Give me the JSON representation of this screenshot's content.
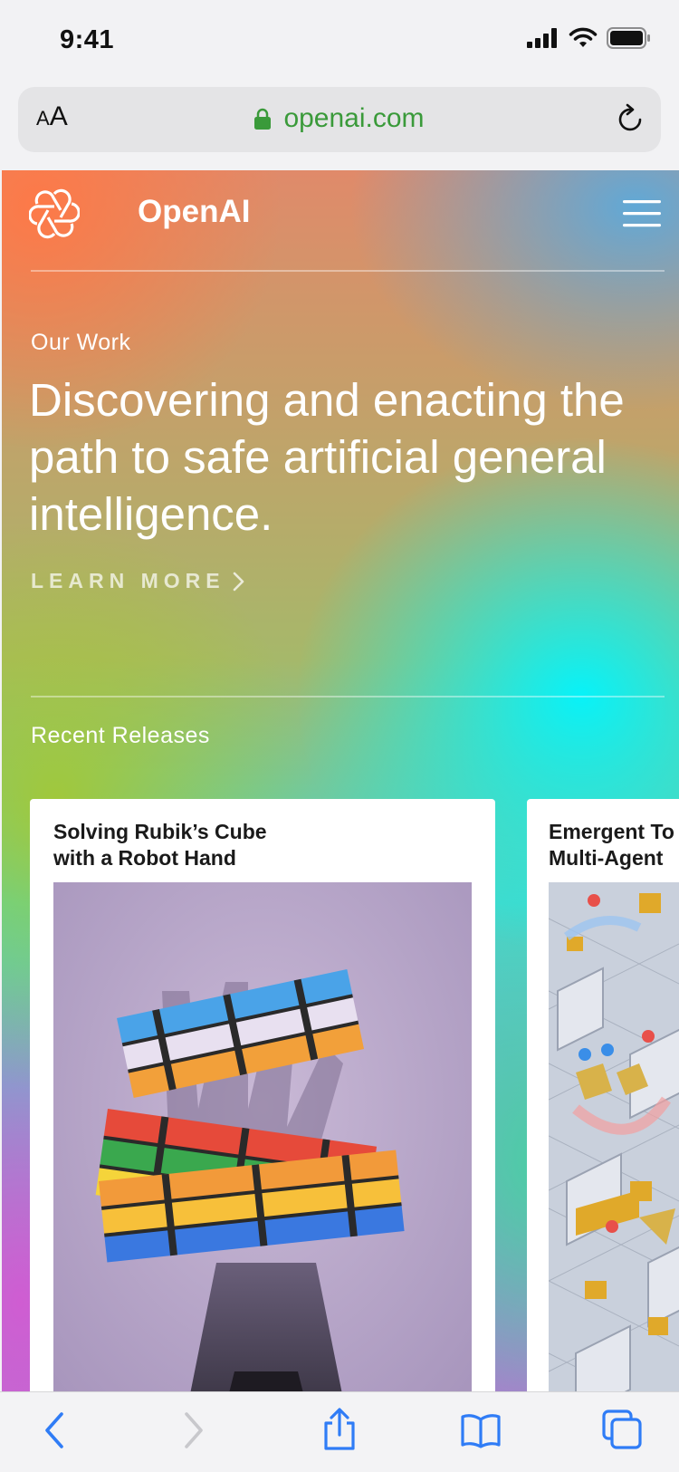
{
  "status_bar": {
    "time": "9:41"
  },
  "url_bar": {
    "text_size_small": "A",
    "text_size_large": "A",
    "url": "openai.com"
  },
  "site": {
    "brand": "OpenAI",
    "section_label": "Our Work",
    "headline": "Discovering and enacting the path to safe artificial general intelligence.",
    "cta": "LEARN MORE",
    "releases_label": "Recent Releases",
    "cards": [
      {
        "title": "Solving Rubik’s Cube\nwith a Robot Hand"
      },
      {
        "title": "Emergent To\nMulti-Agent"
      }
    ]
  },
  "colors": {
    "accent": "#2f7cf6",
    "url_green": "#3a9a3a",
    "disabled": "#c8c8cc"
  },
  "icons": [
    "signal-icon",
    "wifi-icon",
    "battery-icon",
    "lock-icon",
    "reload-icon",
    "openai-logo-icon",
    "hamburger-menu-icon",
    "chevron-right-icon",
    "back-icon",
    "forward-icon",
    "share-icon",
    "bookmarks-icon",
    "tabs-icon"
  ]
}
